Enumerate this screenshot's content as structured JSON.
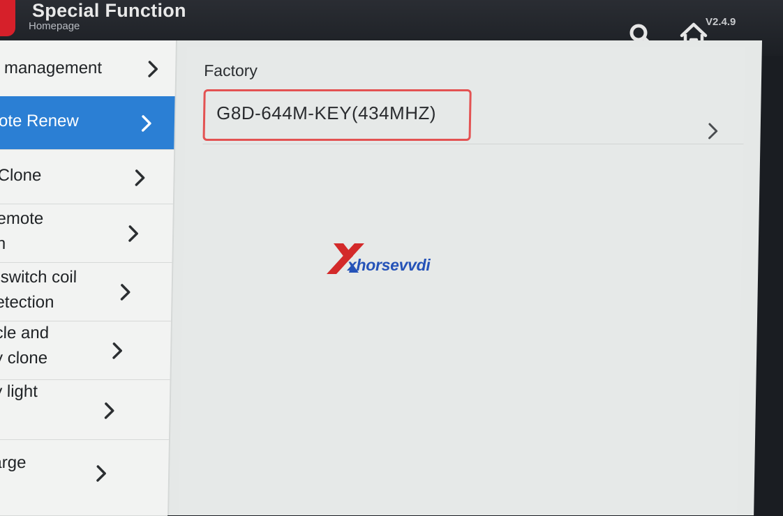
{
  "header": {
    "title": "Special Function",
    "subtitle": "Homepage",
    "version": "V2.4.9",
    "search_icon": "search-icon",
    "home_icon": "home-icon"
  },
  "sidebar": {
    "items": [
      {
        "label": " management",
        "active": false
      },
      {
        "label": "ote Renew",
        "active": true
      },
      {
        "label": "Clone",
        "active": false
      },
      {
        "label": "emote\nn",
        "active": false
      },
      {
        "label": " switch coil\netection",
        "active": false
      },
      {
        "label": "cle and\ny clone",
        "active": false
      },
      {
        "label": "y light",
        "active": false
      },
      {
        "label": "arge",
        "active": false
      }
    ]
  },
  "content": {
    "section_title": "Factory",
    "items": [
      {
        "label": "G8D-644M-KEY(434MHZ)"
      }
    ]
  },
  "watermark": {
    "brand": "xhorsevvdi"
  },
  "colors": {
    "accent_blue": "#2b7fd4",
    "highlight_red": "#e35252",
    "brand_red": "#d6202a"
  }
}
